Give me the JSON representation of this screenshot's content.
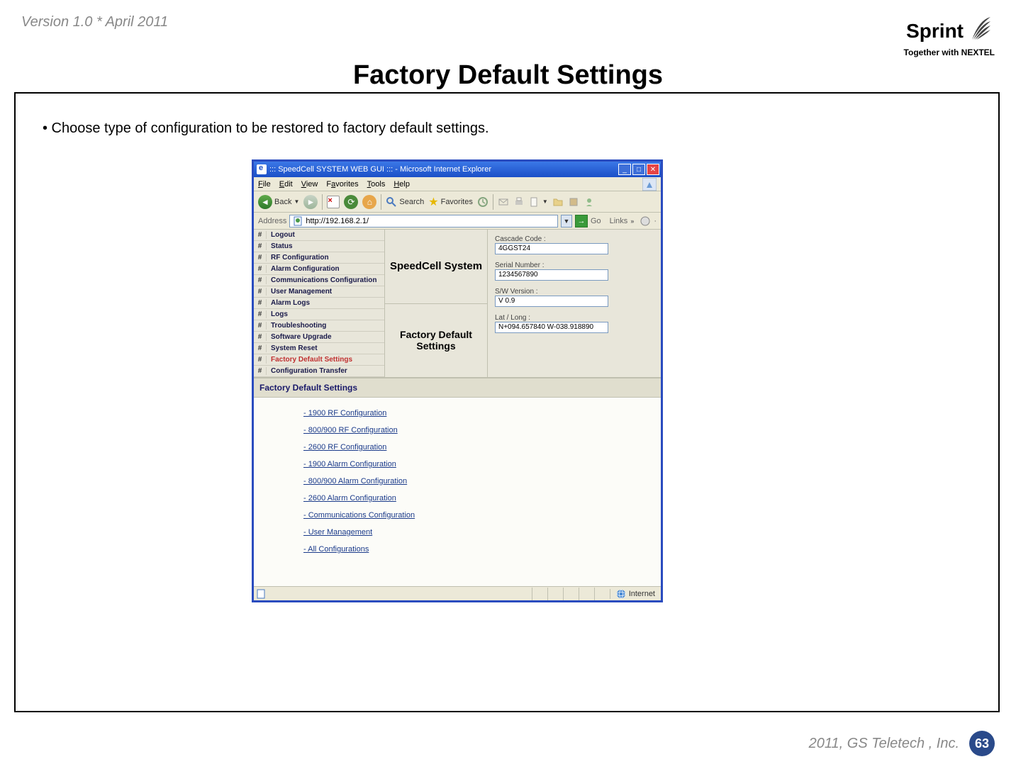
{
  "header": {
    "version": "Version 1.0 * April 2011",
    "brand": "Sprint",
    "tagline": "Together with NEXTEL"
  },
  "slide": {
    "title": "Factory Default Settings",
    "bullet": "• Choose type of configuration to be restored to factory default settings."
  },
  "window": {
    "title": "::: SpeedCell SYSTEM WEB GUI ::: - Microsoft Internet Explorer",
    "menus": [
      "File",
      "Edit",
      "View",
      "Favorites",
      "Tools",
      "Help"
    ],
    "toolbar": {
      "back": "Back",
      "search": "Search",
      "favorites": "Favorites"
    },
    "address_label": "Address",
    "address_value": "http://192.168.2.1/",
    "go": "Go",
    "links_label": "Links"
  },
  "sidebar": {
    "hash": "#",
    "items": [
      {
        "label": "Logout",
        "active": false
      },
      {
        "label": "Status",
        "active": false
      },
      {
        "label": "RF Configuration",
        "active": false
      },
      {
        "label": "Alarm Configuration",
        "active": false
      },
      {
        "label": "Communications Configuration",
        "active": false
      },
      {
        "label": "User Management",
        "active": false
      },
      {
        "label": "Alarm Logs",
        "active": false
      },
      {
        "label": "Logs",
        "active": false
      },
      {
        "label": "Troubleshooting",
        "active": false
      },
      {
        "label": "Software Upgrade",
        "active": false
      },
      {
        "label": "System Reset",
        "active": false
      },
      {
        "label": "Factory Default Settings",
        "active": true
      },
      {
        "label": "Configuration Transfer",
        "active": false
      }
    ]
  },
  "center": {
    "title1": "SpeedCell System",
    "title2": "Factory Default Settings"
  },
  "fields": {
    "cascade_label": "Cascade Code :",
    "cascade_value": "4GGST24",
    "serial_label": "Serial Number :",
    "serial_value": "1234567890",
    "sw_label": "S/W Version :",
    "sw_value": "V 0.9",
    "latlong_label": "Lat / Long :",
    "latlong_value": "N+094.657840 W-038.918890"
  },
  "section_header": "Factory Default Settings",
  "config_links": [
    "- 1900 RF Configuration ",
    "- 800/900 RF Configuration ",
    "- 2600 RF Configuration ",
    "- 1900 Alarm Configuration ",
    "- 800/900 Alarm Configuration ",
    "- 2600 Alarm Configuration ",
    "- Communications Configuration ",
    "- User Management ",
    "- All Configurations "
  ],
  "status": {
    "zone": "Internet"
  },
  "footer": {
    "copyright": "2011, GS Teletech , Inc.",
    "page": "63"
  }
}
